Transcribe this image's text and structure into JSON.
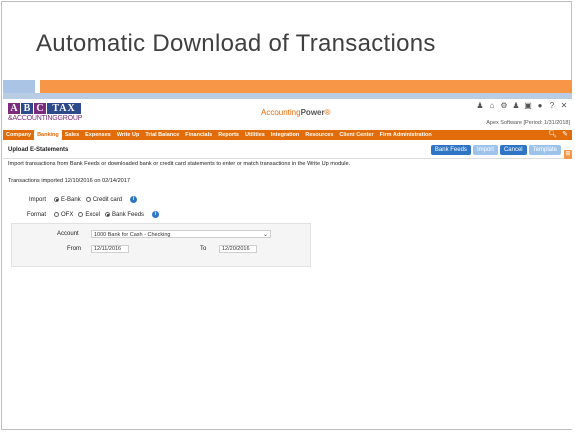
{
  "slide": {
    "title": "Automatic Download  of Transactions"
  },
  "app": {
    "logo": {
      "letters": [
        "A",
        "B",
        "C",
        "TAX"
      ],
      "subtitle": "&ACCOUNTINGGROUP"
    },
    "brand": {
      "name": "Accounting",
      "power": "Power",
      "mark": "®"
    },
    "header_icons": [
      "user-icon",
      "home-icon",
      "gear-icon",
      "profile-icon",
      "document-icon",
      "chat-icon",
      "help-icon",
      "close-icon"
    ],
    "header_icon_glyphs": [
      "♟",
      "⌂",
      "⚙",
      "♟",
      "▣",
      "●",
      "?",
      "✕"
    ],
    "company_info": "Apex Software [Period: 1/31/2018]",
    "nav": [
      "Company",
      "Banking",
      "Sales",
      "Expenses",
      "Write Up",
      "Trial Balance",
      "Financials",
      "Reports",
      "Utilities",
      "Integration",
      "Resources",
      "Client Center",
      "Firm Administration"
    ],
    "nav_active": "Banking",
    "nav_right_glyphs": [
      "🔍︎",
      "✎"
    ]
  },
  "page": {
    "heading": "Upload E-Statements",
    "buttons": {
      "bank_feeds": "Bank Feeds",
      "import": "Import",
      "cancel": "Cancel",
      "template": "Template"
    },
    "description": "Import transactions from Bank Feeds or downloaded bank or credit card statements to enter or match transactions in the Write Up module.",
    "imported_note": "Transactions imported 12/10/2016 on 02/14/2017",
    "import_row": {
      "label": "Import",
      "options": [
        "E-Bank",
        "Credit card"
      ],
      "selected": "E-Bank"
    },
    "format_row": {
      "label": "Format",
      "options": [
        "OFX",
        "Excel",
        "Bank Feeds"
      ],
      "selected": "Bank Feeds"
    },
    "filter": {
      "account_label": "Account",
      "account_value": "1000 Bank for Cash - Checking",
      "from_label": "From",
      "from_value": "12/11/2016",
      "to_label": "To",
      "to_value": "12/20/2016"
    },
    "info_glyph": "i",
    "side_tag_glyph": "⊞"
  }
}
